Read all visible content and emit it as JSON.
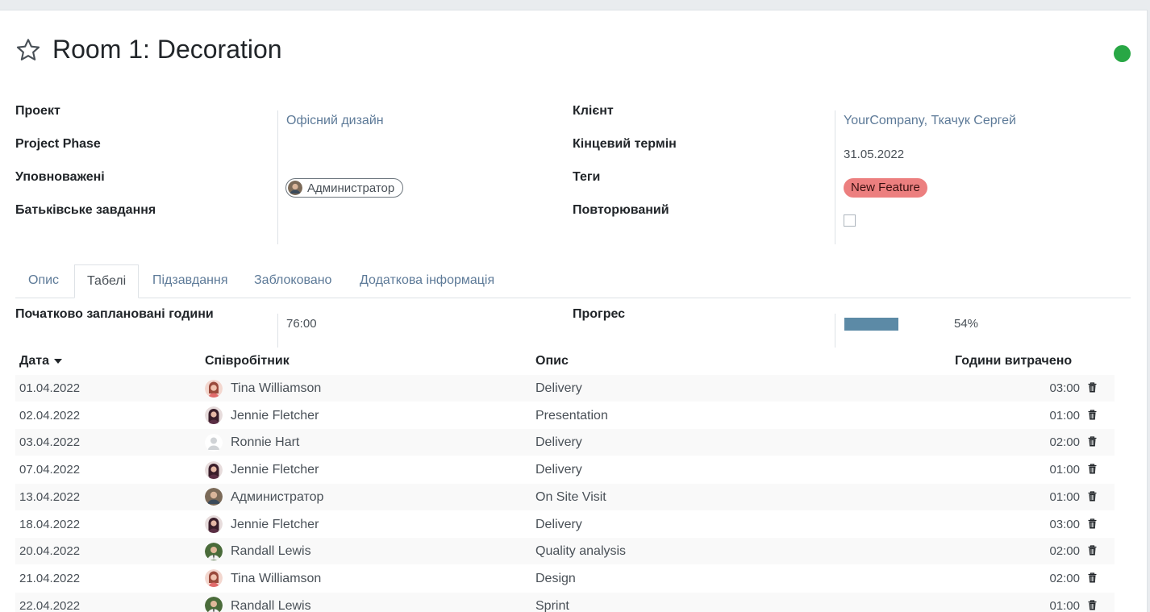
{
  "record": {
    "title": "Room 1: Decoration",
    "starred": false,
    "status_color": "#28a745"
  },
  "fields_left": [
    {
      "label": "Проект",
      "value": "Офісний дизайн",
      "is_link": true
    },
    {
      "label": "Project Phase",
      "value": ""
    },
    {
      "label": "Уповноважені",
      "value": "Администратор",
      "is_avatar": true
    },
    {
      "label": "Батьківське завдання",
      "value": ""
    }
  ],
  "fields_right": [
    {
      "label": "Клієнт",
      "value": "YourCompany, Ткачук Сергей",
      "is_link": true
    },
    {
      "label": "Кінцевий термін",
      "value": "31.05.2022"
    },
    {
      "label": "Теги",
      "value": "New Feature",
      "is_tag": true,
      "tag_color": "#ec7f7f"
    },
    {
      "label": "Повторюваний",
      "value": "",
      "checked": false
    }
  ],
  "tabs": [
    {
      "label": "Опис",
      "active": false
    },
    {
      "label": "Табелі",
      "active": true
    },
    {
      "label": "Підзавдання",
      "active": false
    },
    {
      "label": "Заблоковано",
      "active": false
    },
    {
      "label": "Додаткова інформація",
      "active": false
    }
  ],
  "timesheet_summary": {
    "planned_label": "Початково заплановані години",
    "planned_value": "76:00",
    "progress_label": "Прогрес",
    "progress_percent": 54,
    "progress_text": "54%"
  },
  "table": {
    "columns": [
      "Дата",
      "Співробітник",
      "Опис",
      "Години витрачено"
    ],
    "sort_column": "Дата",
    "sort_dir": "desc",
    "rows": [
      {
        "date": "01.04.2022",
        "employee": "Tina Williamson",
        "avatar": "tina",
        "desc": "Delivery",
        "hours": "03:00"
      },
      {
        "date": "02.04.2022",
        "employee": "Jennie Fletcher",
        "avatar": "jennie",
        "desc": "Presentation",
        "hours": "01:00"
      },
      {
        "date": "03.04.2022",
        "employee": "Ronnie Hart",
        "avatar": "placeholder",
        "desc": "Delivery",
        "hours": "02:00"
      },
      {
        "date": "07.04.2022",
        "employee": "Jennie Fletcher",
        "avatar": "jennie",
        "desc": "Delivery",
        "hours": "01:00"
      },
      {
        "date": "13.04.2022",
        "employee": "Администратор",
        "avatar": "admin",
        "desc": "On Site Visit",
        "hours": "01:00"
      },
      {
        "date": "18.04.2022",
        "employee": "Jennie Fletcher",
        "avatar": "jennie",
        "desc": "Delivery",
        "hours": "03:00"
      },
      {
        "date": "20.04.2022",
        "employee": "Randall Lewis",
        "avatar": "randall",
        "desc": "Quality analysis",
        "hours": "02:00"
      },
      {
        "date": "21.04.2022",
        "employee": "Tina Williamson",
        "avatar": "tina",
        "desc": "Design",
        "hours": "02:00"
      },
      {
        "date": "22.04.2022",
        "employee": "Randall Lewis",
        "avatar": "randall",
        "desc": "Sprint",
        "hours": "01:00"
      }
    ]
  },
  "icons": {
    "star": "star-outline-icon",
    "sort": "caret-down-icon",
    "delete": "trash-icon"
  },
  "colors": {
    "link": "#5d7a98",
    "progress": "#5c8aa6",
    "status": "#28a745"
  }
}
